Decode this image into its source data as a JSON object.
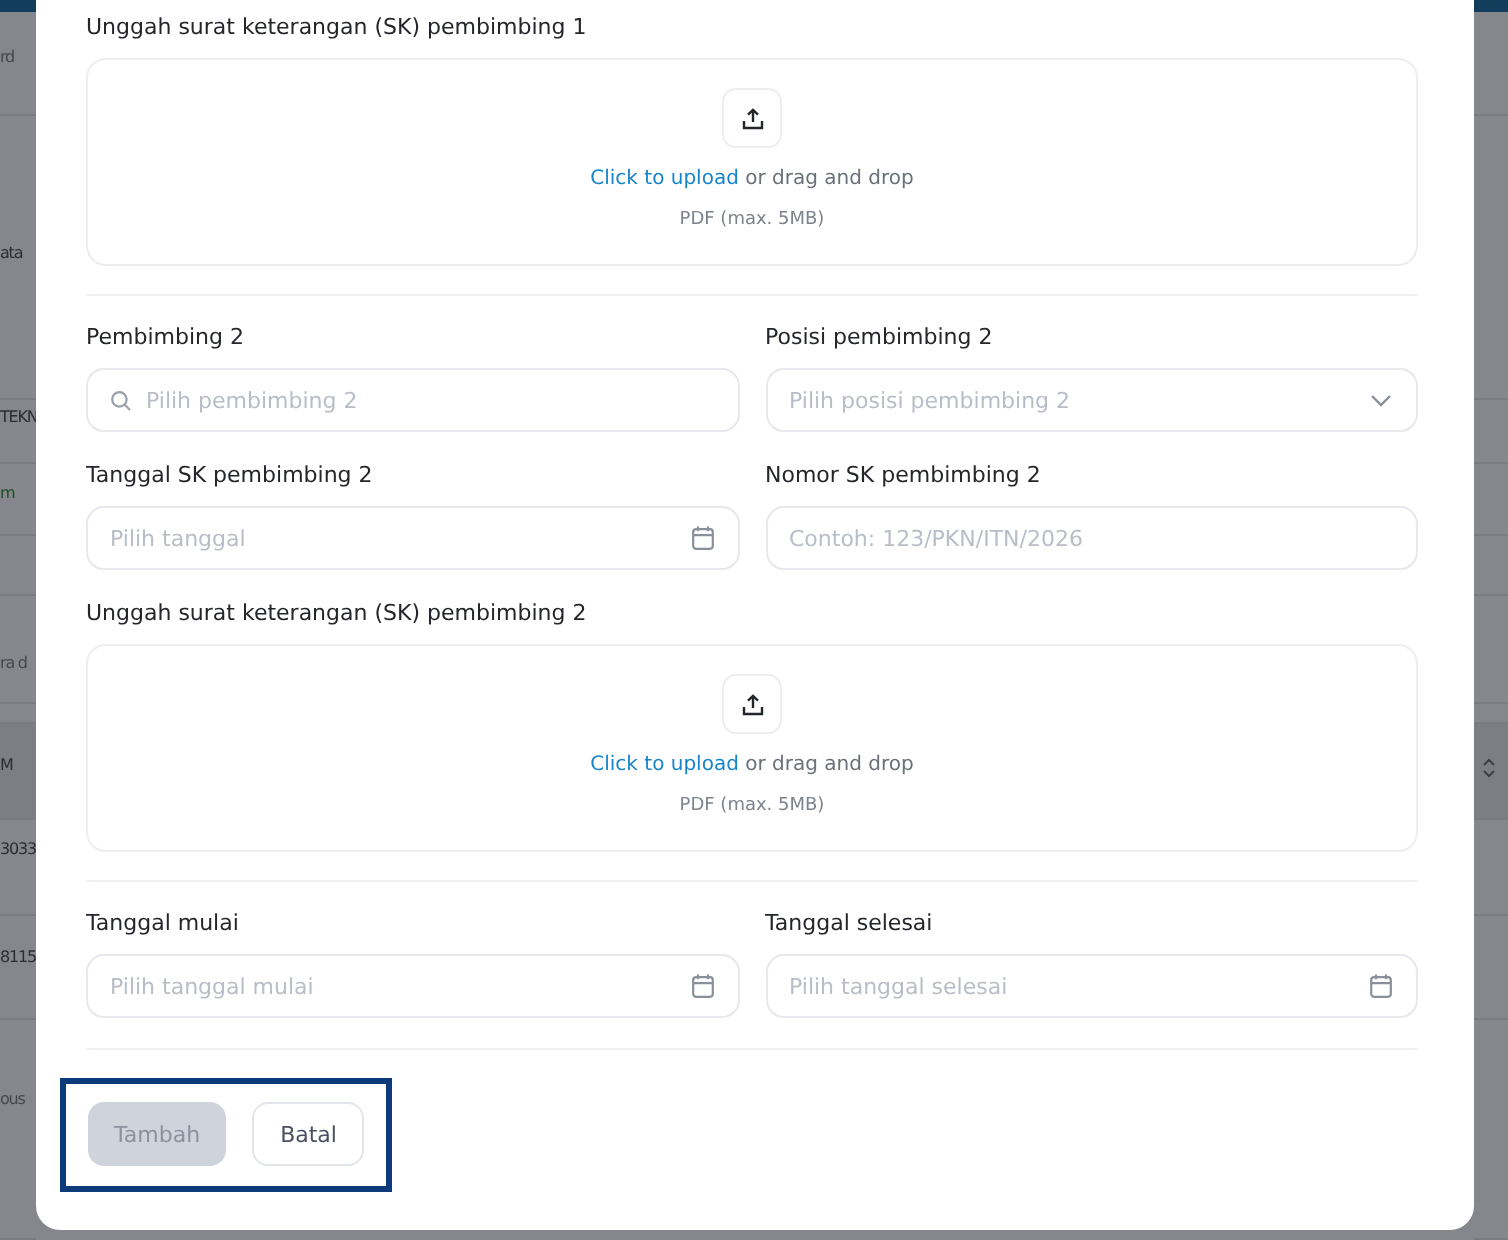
{
  "backdrop": {
    "rows": [
      {
        "text": "rd",
        "kind": "placeholder"
      },
      {
        "text": "ata",
        "kind": "cell"
      },
      {
        "text": "TEKN",
        "kind": "cell"
      },
      {
        "text": "m",
        "kind": "accent"
      },
      {
        "text": "",
        "kind": "blank"
      },
      {
        "text": "ra d",
        "kind": "placeholder"
      },
      {
        "text": "",
        "kind": "blank"
      },
      {
        "text": "M",
        "kind": "header"
      },
      {
        "text": "3033",
        "kind": "cell"
      },
      {
        "text": "8115",
        "kind": "cell"
      },
      {
        "text": "ous",
        "kind": "placeholder"
      }
    ]
  },
  "form": {
    "sections": [
      {
        "kind": "upload",
        "label": "Unggah surat keterangan (SK) pembimbing 1",
        "link": "Click to upload",
        "rest": "or drag and drop",
        "hint": "PDF (max. 5MB)"
      },
      {
        "kind": "row",
        "fields": [
          {
            "label": "Pembimbing 2",
            "placeholder": "Pilih pembimbing 2",
            "kind": "search"
          },
          {
            "label": "Posisi pembimbing 2",
            "placeholder": "Pilih posisi pembimbing 2",
            "kind": "select"
          }
        ]
      },
      {
        "kind": "row",
        "fields": [
          {
            "label": "Tanggal SK pembimbing 2",
            "placeholder": "Pilih tanggal",
            "kind": "date"
          },
          {
            "label": "Nomor SK pembimbing 2",
            "placeholder": "Contoh: 123/PKN/ITN/2026",
            "kind": "text"
          }
        ]
      },
      {
        "kind": "upload",
        "label": "Unggah surat keterangan (SK) pembimbing 2",
        "link": "Click to upload",
        "rest": "or drag and drop",
        "hint": "PDF (max. 5MB)"
      },
      {
        "kind": "row",
        "fields": [
          {
            "label": "Tanggal mulai",
            "placeholder": "Pilih tanggal mulai",
            "kind": "date"
          },
          {
            "label": "Tanggal selesai",
            "placeholder": "Pilih tanggal selesai",
            "kind": "date"
          }
        ]
      }
    ],
    "buttons": [
      {
        "label": "Tambah",
        "kind": "primary",
        "disabled": true
      },
      {
        "label": "Batal",
        "kind": "secondary",
        "disabled": false
      }
    ]
  }
}
